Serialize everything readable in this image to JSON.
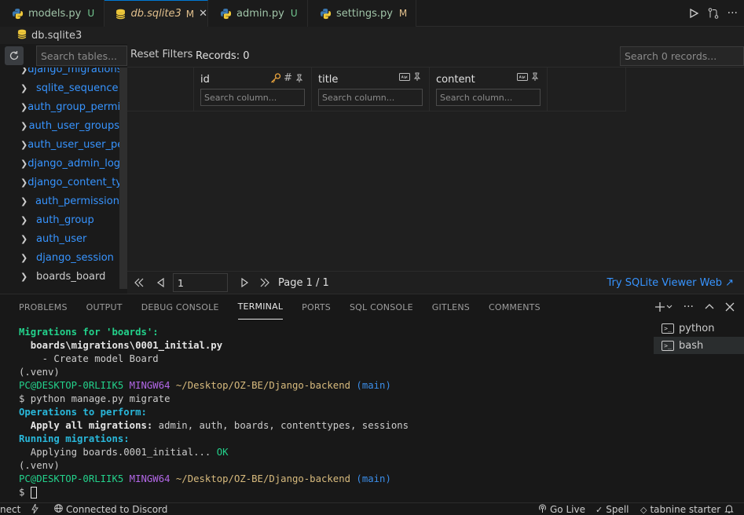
{
  "tabs": [
    {
      "label": "models.py",
      "status": "U",
      "icon": "python-icon"
    },
    {
      "label": "db.sqlite3",
      "status": "M",
      "icon": "database-icon",
      "active": true
    },
    {
      "label": "admin.py",
      "status": "U",
      "icon": "python-icon"
    },
    {
      "label": "settings.py",
      "status": "M",
      "icon": "python-icon"
    }
  ],
  "breadcrumb": {
    "file": "db.sqlite3"
  },
  "viewer": {
    "table_search_placeholder": "Search tables...",
    "reset_filters": "Reset Filters",
    "records": "Records: 0",
    "records_search_placeholder": "Search 0 records...",
    "tables": [
      "django_migrations",
      "sqlite_sequence",
      "auth_group_permissions",
      "auth_user_groups",
      "auth_user_user_permissions",
      "django_admin_log",
      "django_content_type",
      "auth_permission",
      "auth_group",
      "auth_user",
      "django_session",
      "boards_board"
    ],
    "columns": [
      {
        "name": "id",
        "search_placeholder": "Search column..."
      },
      {
        "name": "title",
        "search_placeholder": "Search column..."
      },
      {
        "name": "content",
        "search_placeholder": "Search column..."
      }
    ],
    "page_value": "1",
    "page_info": "Page 1 / 1",
    "try_link": "Try SQLite Viewer Web ↗"
  },
  "panel": {
    "tabs": [
      "PROBLEMS",
      "OUTPUT",
      "DEBUG CONSOLE",
      "TERMINAL",
      "PORTS",
      "SQL CONSOLE",
      "GITLENS",
      "COMMENTS"
    ],
    "active_tab": "TERMINAL",
    "terminals": [
      "python",
      "bash"
    ]
  },
  "terminal": {
    "l1": "Migrations for 'boards':",
    "l2": "  boards\\migrations\\0001_initial.py",
    "l3": "    - Create model Board",
    "l4": "(.venv)",
    "prompt_user": "PC@DESKTOP-0RLIIK5",
    "prompt_shell": "MINGW64",
    "prompt_path": "~/Desktop/OZ-BE/Django-backend",
    "prompt_branch": "(main)",
    "cmd": "$ python manage.py migrate",
    "ops_header": "Operations to perform:",
    "apply_label": "  Apply all migrations:",
    "apply_value": " admin, auth, boards, contenttypes, sessions",
    "running": "Running migrations:",
    "applying": "  Applying boards.0001_initial...",
    "ok": " OK",
    "l13": "(.venv)",
    "dollar": "$ "
  },
  "statusbar": {
    "left_partial": "nect",
    "discord": "Connected to Discord",
    "golive": "Go Live",
    "spell": "Spell",
    "tabnine": "tabnine starter"
  }
}
